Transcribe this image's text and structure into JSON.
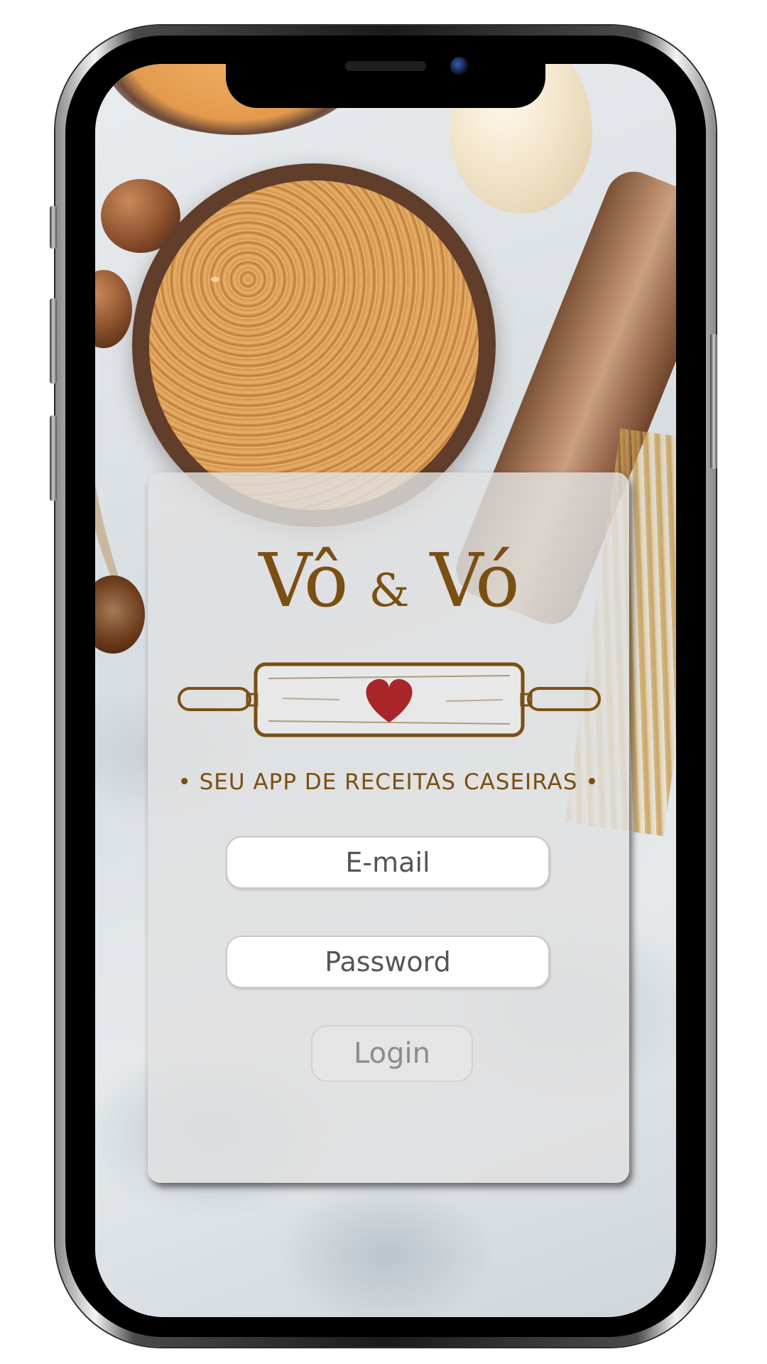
{
  "app": {
    "brand": {
      "name_part1": "Vô",
      "ampersand": "&",
      "name_part2": "Vó",
      "tagline": "• SEU APP DE RECEITAS CASEIRAS •"
    }
  },
  "login_form": {
    "email_placeholder": "E-mail",
    "password_placeholder": "Password",
    "login_label": "Login"
  },
  "colors": {
    "brand_brown": "#7a4f12",
    "heart_red": "#a8262a",
    "card_background": "#e0e0e0"
  },
  "icons": {
    "logo_graphic": "rolling-pin-heart-icon"
  }
}
